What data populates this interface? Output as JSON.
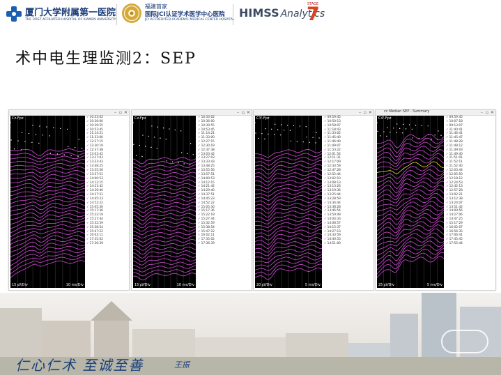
{
  "header": {
    "hospital_name_cn": "厦门大学附属第一医院",
    "hospital_name_en": "THE FIRST AFFILIATED HOSPITAL OF XIAMEN UNIVERSITY",
    "jci_line1": "福建首家",
    "jci_line2": "国际JCI认证学术医学中心医院",
    "jci_line3": "JCI ACCREDITED ACADEMIC MEDICAL CENTER HOSPITAL",
    "himss_brand": "HIMSS",
    "himss_analytics": "Analytics",
    "stage_label": "STAGE",
    "stage_number": "7"
  },
  "slide": {
    "title": "术中电生理监测2：SEP"
  },
  "panels": [
    {
      "window_title": "",
      "channel": "Cz-Fpz",
      "left_scale": "15 ㎶/Div",
      "right_scale": "10 ms/Div",
      "timestamps": [
        "10:33:02",
        "10:36:00",
        "10:39:55",
        "10:53:45",
        "11:14:21",
        "11:33:00",
        "12:27:15",
        "12:30:19",
        "12:37:38",
        "13:03:42",
        "13:27:03",
        "13:33:43",
        "13:48:25",
        "13:55:56",
        "13:57:51",
        "14:00:53",
        "14:12:15",
        "14:21:42",
        "14:29:40",
        "14:37:51",
        "14:45:23",
        "14:52:22",
        "15:05:30",
        "15:17:36",
        "15:22:19",
        "15:27:44",
        "15:32:59",
        "15:38:54",
        "15:47:22",
        "16:02:11",
        "17:35:02",
        "17:36:39"
      ]
    },
    {
      "window_title": "",
      "channel": "Cz-Fpz",
      "left_scale": "15 ㎶/Div",
      "right_scale": "10 ms/Div",
      "timestamps": [
        "10:33:02",
        "10:36:00",
        "10:39:55",
        "10:53:45",
        "11:14:21",
        "11:33:00",
        "12:27:15",
        "12:30:19",
        "12:37:38",
        "13:03:42",
        "13:27:03",
        "13:33:43",
        "13:48:25",
        "13:55:56",
        "13:57:51",
        "14:00:53",
        "14:12:15",
        "14:21:42",
        "14:29:40",
        "14:37:51",
        "14:45:23",
        "14:52:22",
        "15:05:30",
        "15:17:36",
        "15:22:19",
        "15:27:44",
        "15:32:59",
        "15:38:54",
        "15:47:22",
        "16:02:11",
        "17:35:02",
        "17:36:39"
      ]
    },
    {
      "window_title": "",
      "channel": "C3'-Fpz",
      "left_scale": "20 ㎶/Div",
      "right_scale": "5 ms/Div",
      "timestamps": [
        "09:59:45",
        "10:50:13",
        "10:58:07",
        "11:18:43",
        "11:33:02",
        "11:45:40",
        "11:46:49",
        "11:49:07",
        "11:53:22",
        "12:01:54",
        "12:11:31",
        "12:17:09",
        "12:33:59",
        "12:47:28",
        "12:52:44",
        "13:02:10",
        "13:08:13",
        "13:13:26",
        "13:19:36",
        "13:25:44",
        "13:28:59",
        "13:34:44",
        "13:38:28",
        "13:46:54",
        "13:59:49",
        "14:04:33",
        "14:08:57",
        "14:15:37",
        "14:27:13",
        "14:33:59",
        "14:40:53",
        "14:51:00"
      ]
    },
    {
      "window_title": "cc Median SEP - Summary",
      "channel": "C4'-Fpz",
      "left_scale": "25 ㎶/Div",
      "right_scale": "5 ms/Div",
      "timestamps": [
        "09:59:45",
        "10:07:18",
        "09:13:07",
        "11:40:41",
        "11:46:41",
        "11:45:47",
        "11:48:28",
        "11:48:12",
        "11:49:03",
        "11:49:40",
        "11:51:01",
        "11:52:11",
        "11:52:40",
        "12:03:44",
        "12:05:50",
        "12:18:12",
        "12:24:53",
        "12:42:13",
        "12:57:28",
        "13:02:21",
        "13:12:38",
        "13:24:07",
        "13:51:42",
        "14:09:56",
        "14:27:06",
        "14:47:25",
        "15:17:29",
        "16:02:07",
        "16:56:35",
        "17:06:41",
        "17:45:45",
        "17:55:44"
      ]
    }
  ],
  "footer": {
    "motto": "仁心仁术 至诚至善",
    "signature": "王振"
  }
}
